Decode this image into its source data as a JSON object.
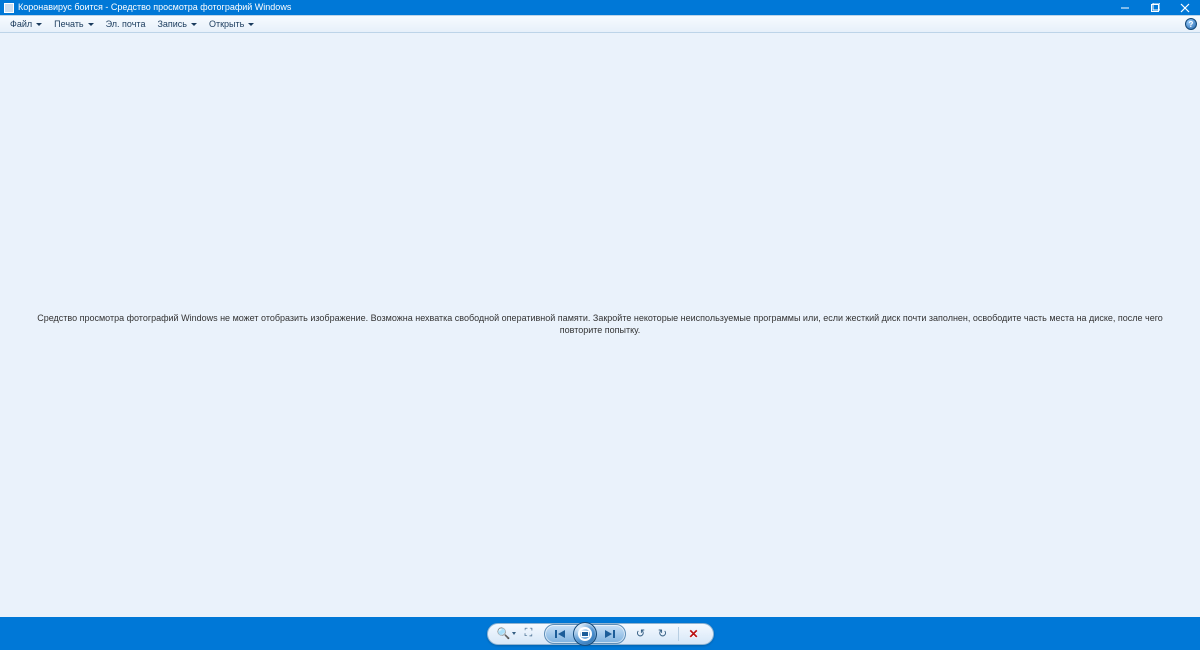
{
  "title": "Коронавирус боится - Средство просмотра фотографий Windows",
  "toolbar": {
    "file": "Файл",
    "print": "Печать",
    "email": "Эл. почта",
    "burn": "Запись",
    "open": "Открыть"
  },
  "help_glyph": "?",
  "error_message": "Средство просмотра фотографий Windows не может отобразить изображение. Возможна нехватка свободной оперативной памяти. Закройте некоторые неиспользуемые программы или, если жесткий диск почти заполнен, освободите часть места на диске, после чего повторите попытку.",
  "controls": {
    "zoom_glyph": "🔍",
    "fit_glyph": "⛶",
    "prev_glyph": "I◀",
    "next_glyph": "▶I",
    "ccw_glyph": "↺",
    "cw_glyph": "↻",
    "delete_glyph": "✕"
  }
}
